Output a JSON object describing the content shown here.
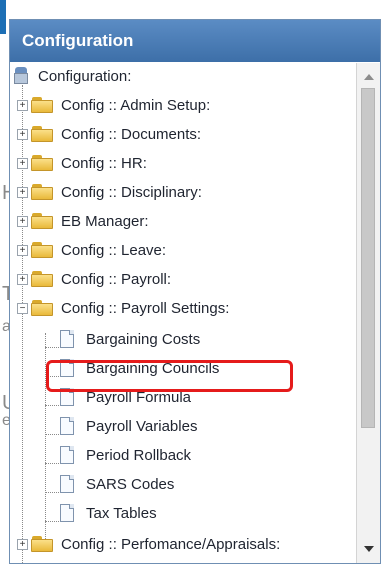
{
  "panel": {
    "title": "Configuration"
  },
  "tree": {
    "root": {
      "label": "Configuration:"
    },
    "folders": [
      {
        "label": "Config :: Admin Setup:",
        "expander": "+"
      },
      {
        "label": "Config :: Documents:",
        "expander": "+"
      },
      {
        "label": "Config :: HR:",
        "expander": "+"
      },
      {
        "label": "Config :: Disciplinary:",
        "expander": "+"
      },
      {
        "label": "EB Manager:",
        "expander": "+"
      },
      {
        "label": "Config :: Leave:",
        "expander": "+"
      },
      {
        "label": "Config :: Payroll:",
        "expander": "+"
      },
      {
        "label": "Config :: Payroll Settings:",
        "expander": "−"
      }
    ],
    "payroll_settings_items": [
      {
        "label": "Bargaining Costs"
      },
      {
        "label": "Bargaining Councils"
      },
      {
        "label": "Payroll Formula"
      },
      {
        "label": "Payroll Variables"
      },
      {
        "label": "Period Rollback"
      },
      {
        "label": "SARS Codes"
      },
      {
        "label": "Tax Tables"
      }
    ],
    "last_folder": {
      "label": "Config :: Perfomance/Appraisals:",
      "expander": "+"
    }
  },
  "highlight": {
    "target": "Bargaining Councils",
    "color": "#e51b1b"
  },
  "background": {
    "fragments": [
      "T",
      "a",
      "U",
      "e",
      "H"
    ]
  }
}
